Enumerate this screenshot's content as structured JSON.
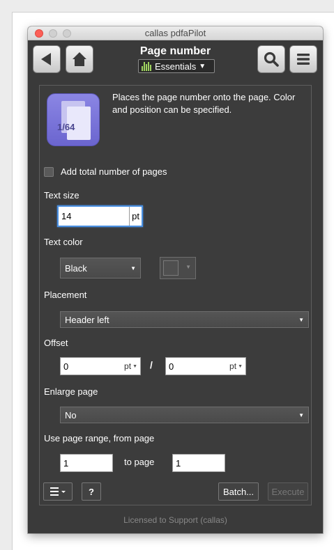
{
  "window": {
    "title": "callas pdfaPilot"
  },
  "toolbar": {
    "back_icon": "back-arrow-icon",
    "home_icon": "home-icon",
    "search_icon": "search-icon",
    "menu_icon": "hamburger-menu-icon",
    "title": "Page number",
    "profile_label": "Essentials"
  },
  "fixup": {
    "icon_label": "1/64",
    "description": "Places the page number onto the page. Color and position can be specified."
  },
  "form": {
    "add_total_label": "Add total number of pages",
    "add_total_checked": false,
    "text_size_label": "Text size",
    "text_size_value": "14",
    "text_size_unit": "pt",
    "text_color_label": "Text color",
    "text_color_value": "Black",
    "placement_label": "Placement",
    "placement_value": "Header left",
    "offset_label": "Offset",
    "offset_x_value": "0",
    "offset_x_unit": "pt",
    "offset_separator": "/",
    "offset_y_value": "0",
    "offset_y_unit": "pt",
    "enlarge_label": "Enlarge page",
    "enlarge_value": "No",
    "range_label": "Use page range, from page",
    "range_from_value": "1",
    "range_to_label": "to page",
    "range_to_value": "1"
  },
  "footer_buttons": {
    "list_icon": "list-menu-icon",
    "help_label": "?",
    "batch_label": "Batch...",
    "execute_label": "Execute"
  },
  "footer": {
    "license_text": "Licensed to Support (callas)"
  },
  "colors": {
    "accent": "#4a90e2",
    "icon_bg": "#7a75dc",
    "panel_bg": "#3c3c3c"
  }
}
